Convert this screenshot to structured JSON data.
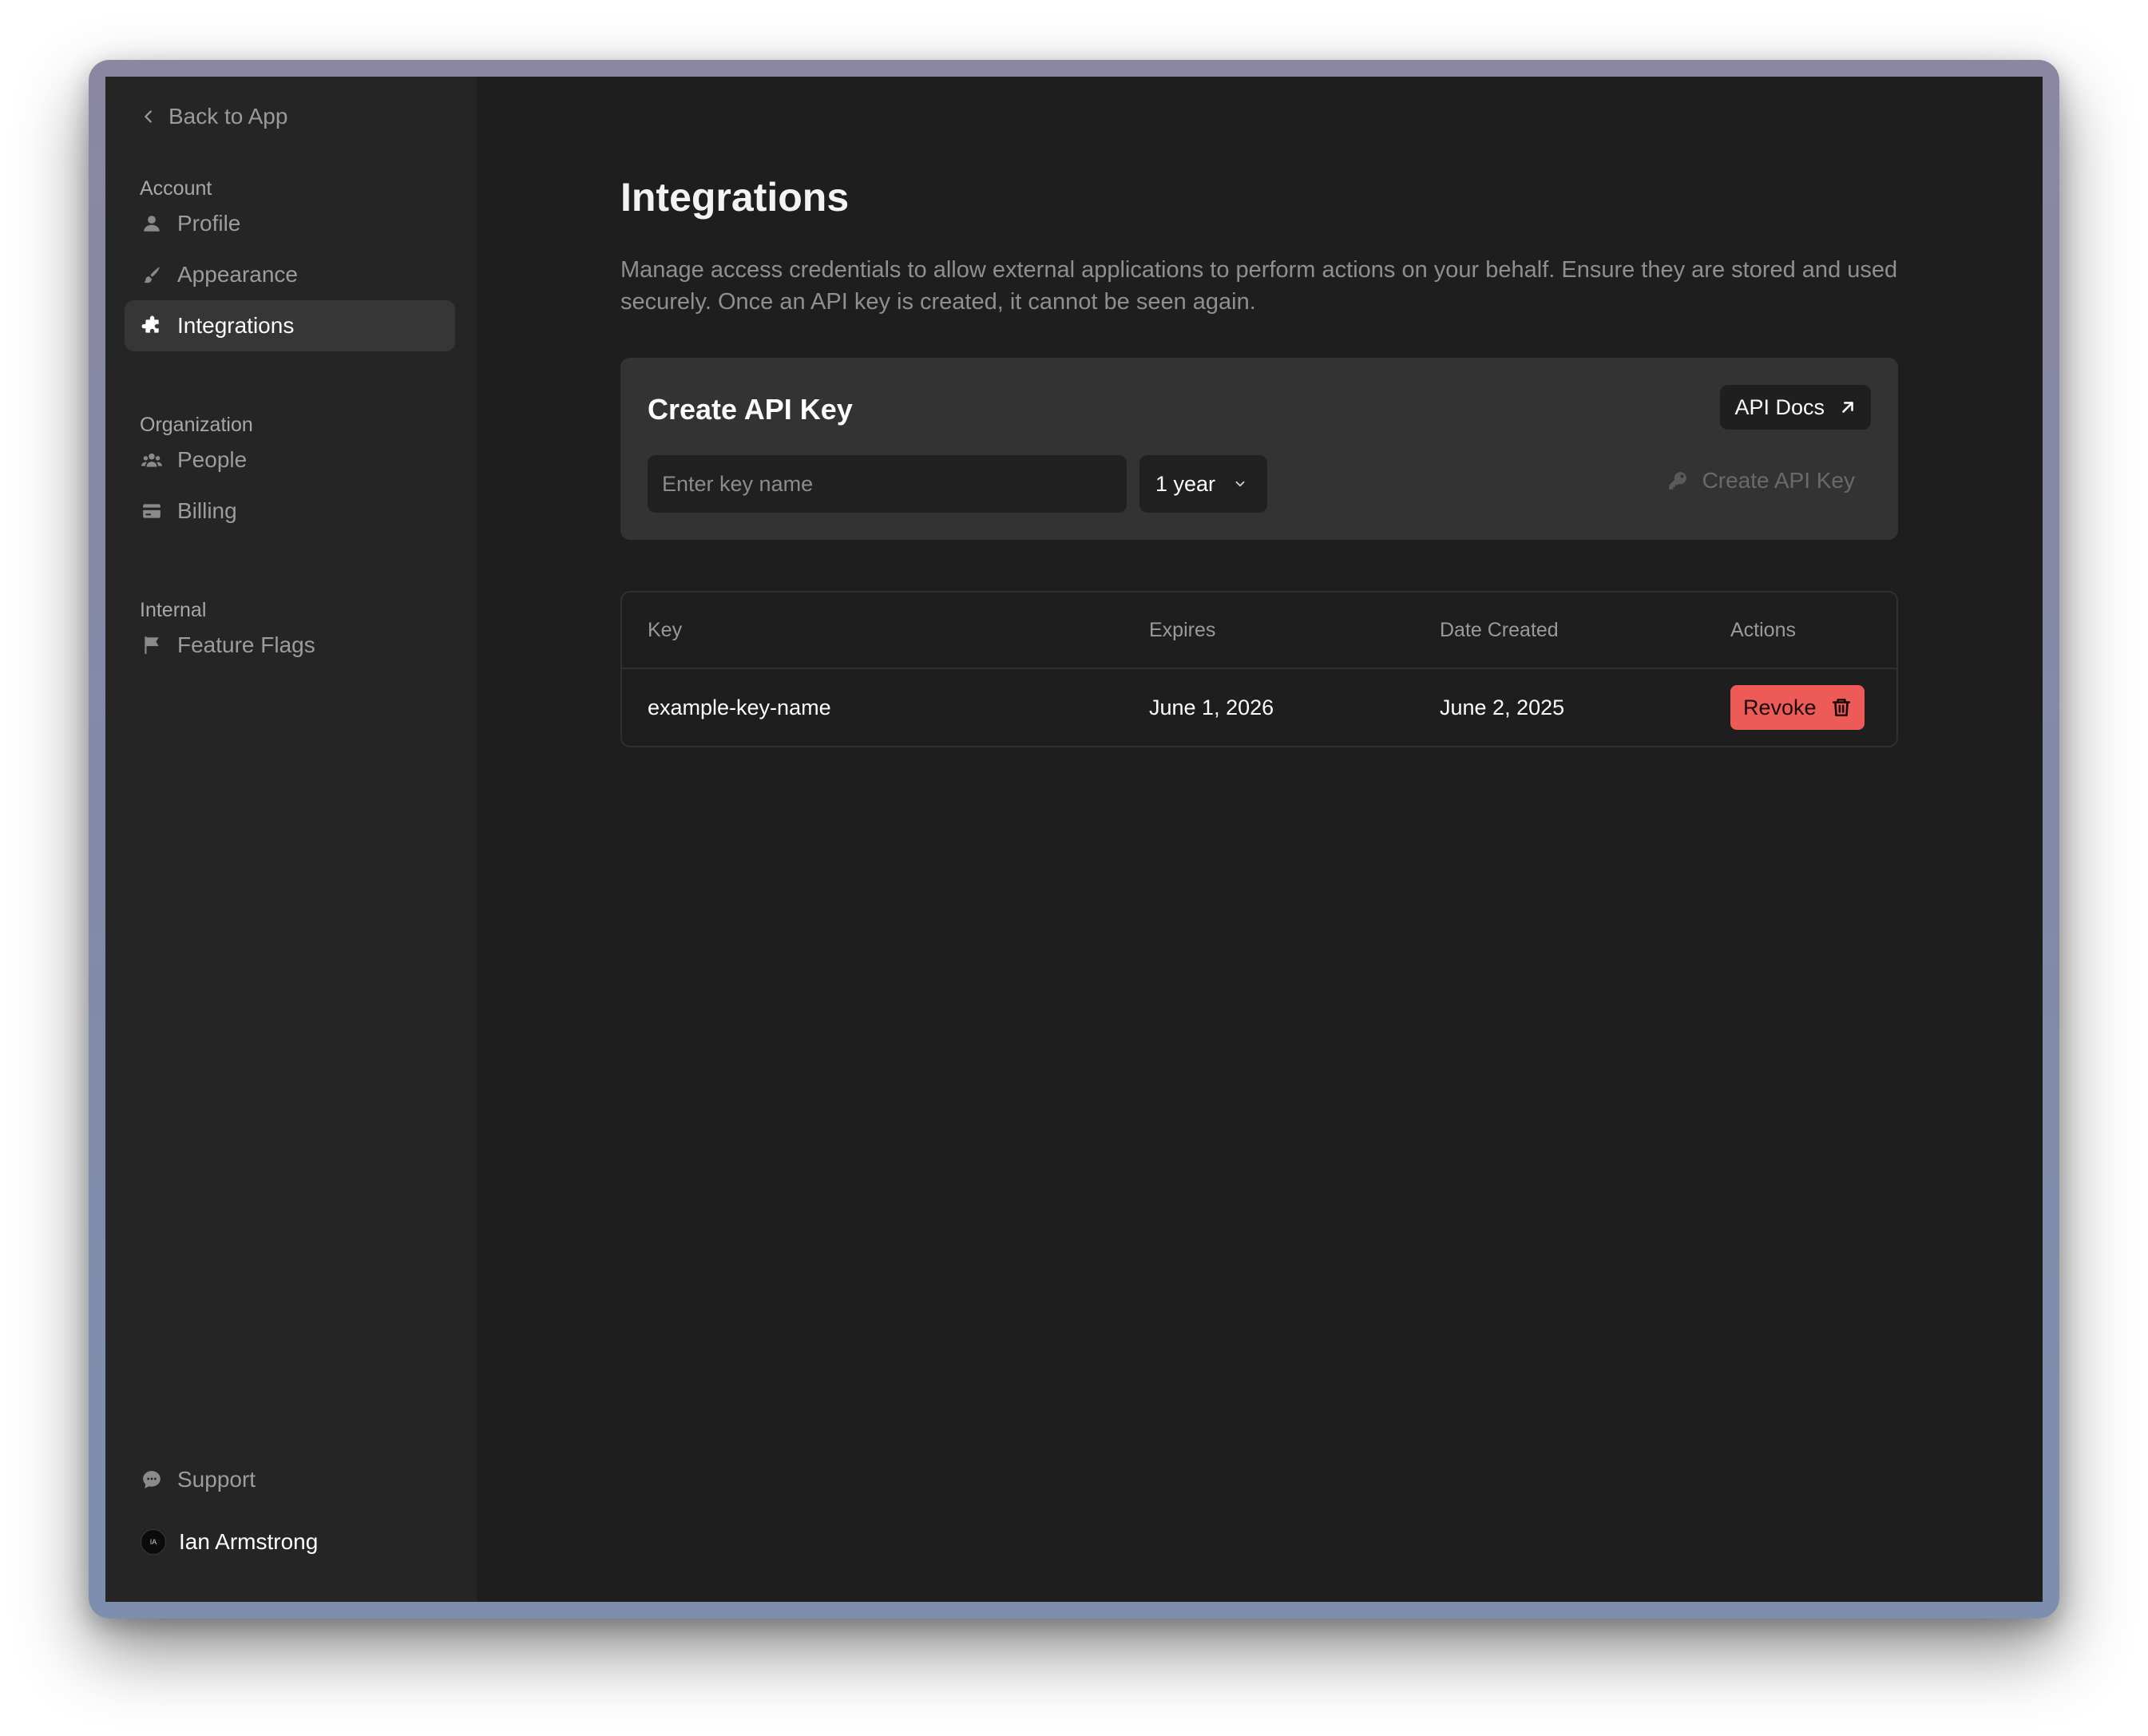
{
  "sidebar": {
    "back_label": "Back to App",
    "sections": [
      {
        "label": "Account"
      },
      {
        "label": "Organization"
      },
      {
        "label": "Internal"
      }
    ],
    "items": [
      {
        "label": "Profile",
        "icon": "user-icon"
      },
      {
        "label": "Appearance",
        "icon": "brush-icon"
      },
      {
        "label": "Integrations",
        "icon": "puzzle-icon",
        "active": true
      },
      {
        "label": "People",
        "icon": "people-icon"
      },
      {
        "label": "Billing",
        "icon": "credit-card-icon"
      },
      {
        "label": "Feature Flags",
        "icon": "flag-icon"
      },
      {
        "label": "Support",
        "icon": "chat-icon"
      }
    ],
    "user": {
      "name": "Ian Armstrong",
      "initials": "IA"
    }
  },
  "main": {
    "title": "Integrations",
    "description": "Manage access credentials to allow external applications to perform actions on your behalf. Ensure they are stored and used securely. Once an API key is created, it cannot be seen again.",
    "create_card": {
      "title": "Create API Key",
      "docs_label": "API Docs",
      "input_placeholder": "Enter key name",
      "input_value": "",
      "expiry_selected": "1 year",
      "create_label": "Create API Key"
    },
    "table": {
      "columns": [
        "Key",
        "Expires",
        "Date Created",
        "Actions"
      ],
      "rows": [
        {
          "key": "example-key-name",
          "expires": "June 1, 2026",
          "created": "June 2, 2025",
          "action_label": "Revoke"
        }
      ]
    }
  },
  "colors": {
    "background": "#1e1e1e",
    "sidebar": "#252525",
    "card": "#333333",
    "danger": "#ee5a55",
    "frame": "#8b87a3"
  }
}
